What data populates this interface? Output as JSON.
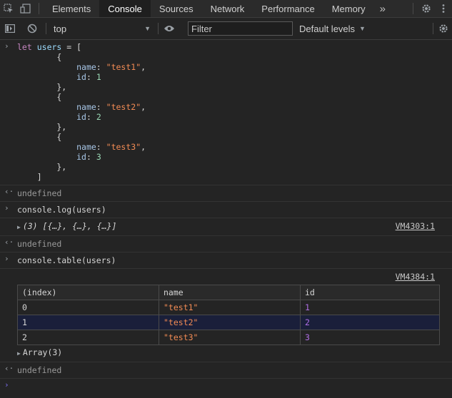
{
  "tabs": [
    "Elements",
    "Console",
    "Sources",
    "Network",
    "Performance",
    "Memory"
  ],
  "active_tab": "Console",
  "toolbar": {
    "context": "top",
    "filter_placeholder": "Filter",
    "levels": "Default levels"
  },
  "console": {
    "code_lines": [
      "let users = [",
      "        {",
      "            name: \"test1\",",
      "            id: 1",
      "        },",
      "        {",
      "            name: \"test2\",",
      "            id: 2",
      "        },",
      "        {",
      "            name: \"test3\",",
      "            id: 3",
      "        },",
      "    ]"
    ],
    "undefined_text": "undefined",
    "log_cmd": "console.log(users)",
    "log_result": "(3) [{…}, {…}, {…}]",
    "log_source": "VM4303:1",
    "table_cmd": "console.table(users)",
    "table_source": "VM4384:1",
    "table": {
      "headers": [
        "(index)",
        "name",
        "id"
      ],
      "rows": [
        [
          "0",
          "\"test1\"",
          "1"
        ],
        [
          "1",
          "\"test2\"",
          "2"
        ],
        [
          "2",
          "\"test3\"",
          "3"
        ]
      ],
      "selected_row": 1
    },
    "array_summary": "Array(3)"
  },
  "icons": [
    "inspect-icon",
    "device-toggle-icon",
    "more-tabs-icon",
    "settings-icon",
    "more-menu-icon",
    "sidebar-toggle-icon",
    "clear-console-icon",
    "eye-icon",
    "console-settings-icon",
    "prompt-icon",
    "result-icon"
  ]
}
